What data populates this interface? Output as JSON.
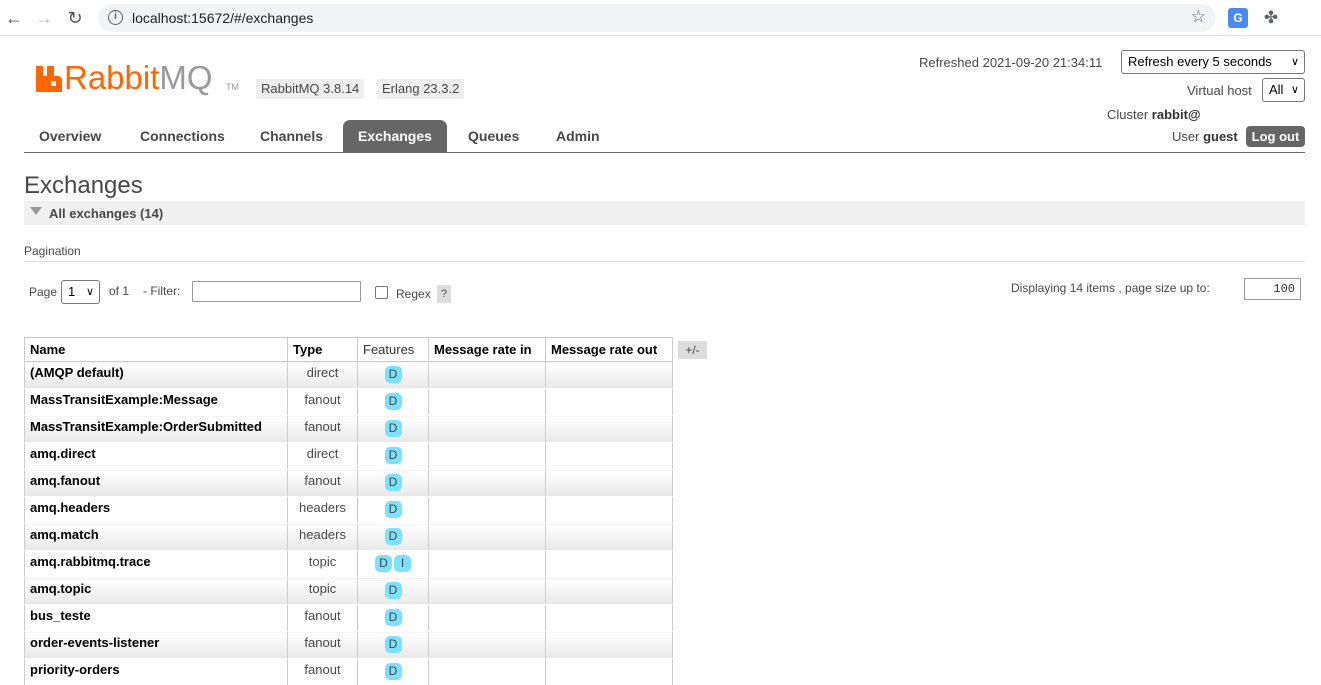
{
  "browser": {
    "url": "localhost:15672/#/exchanges"
  },
  "header": {
    "logo_rabbit": "Rabbit",
    "logo_mq": "MQ",
    "logo_tm": "TM",
    "rabbitmq_version": "RabbitMQ 3.8.14",
    "erlang_version": "Erlang 23.3.2",
    "refreshed": "Refreshed 2021-09-20 21:34:11",
    "refresh_select": "Refresh every 5 seconds",
    "vhost_label": "Virtual host",
    "vhost_select": "All",
    "cluster_label": "Cluster ",
    "cluster_name": "rabbit@",
    "user_label": "User ",
    "user_name": "guest",
    "logout_label": "Log out",
    "brand_color": "#ff6600"
  },
  "tabs": [
    {
      "label": "Overview",
      "active": false
    },
    {
      "label": "Connections",
      "active": false
    },
    {
      "label": "Channels",
      "active": false
    },
    {
      "label": "Exchanges",
      "active": true
    },
    {
      "label": "Queues",
      "active": false
    },
    {
      "label": "Admin",
      "active": false
    }
  ],
  "page": {
    "title": "Exchanges",
    "section_label": "All exchanges (14)"
  },
  "pagination": {
    "section_label": "Pagination",
    "page_label": "Page",
    "page_select": "1",
    "of_label": "of 1",
    "filter_label": "- Filter:",
    "filter_value": "",
    "regex_label": "Regex",
    "help_label": "?",
    "displaying": "Displaying 14 items , page size up to:",
    "page_size": "100"
  },
  "table": {
    "headers": [
      "Name",
      "Type",
      "Features",
      "Message rate in",
      "Message rate out"
    ],
    "toggle_columns": "+/-",
    "rows": [
      {
        "name": "(AMQP default)",
        "type": "direct",
        "features": [
          "D"
        ]
      },
      {
        "name": "MassTransitExample:Message",
        "type": "fanout",
        "features": [
          "D"
        ]
      },
      {
        "name": "MassTransitExample:OrderSubmitted",
        "type": "fanout",
        "features": [
          "D"
        ]
      },
      {
        "name": "amq.direct",
        "type": "direct",
        "features": [
          "D"
        ]
      },
      {
        "name": "amq.fanout",
        "type": "fanout",
        "features": [
          "D"
        ]
      },
      {
        "name": "amq.headers",
        "type": "headers",
        "features": [
          "D"
        ]
      },
      {
        "name": "amq.match",
        "type": "headers",
        "features": [
          "D"
        ]
      },
      {
        "name": "amq.rabbitmq.trace",
        "type": "topic",
        "features": [
          "D",
          "I"
        ]
      },
      {
        "name": "amq.topic",
        "type": "topic",
        "features": [
          "D"
        ]
      },
      {
        "name": "bus_teste",
        "type": "fanout",
        "features": [
          "D"
        ]
      },
      {
        "name": "order-events-listener",
        "type": "fanout",
        "features": [
          "D"
        ]
      },
      {
        "name": "priority-orders",
        "type": "fanout",
        "features": [
          "D"
        ]
      }
    ]
  }
}
